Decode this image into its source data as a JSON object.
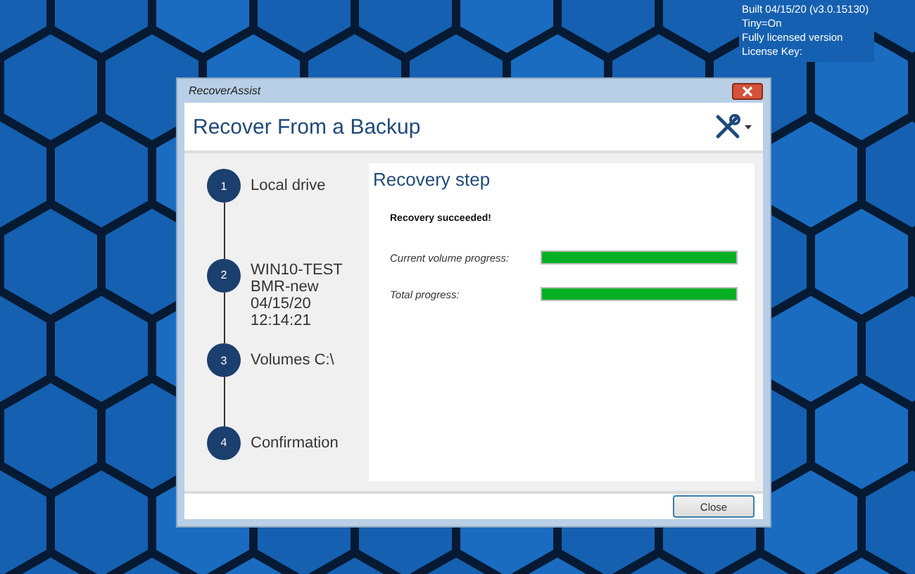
{
  "desktop_info": [
    "Built 04/15/20 (v3.0.15130)",
    "Tiny=On",
    "Fully licensed version",
    "License Key:"
  ],
  "window": {
    "title": "RecoverAssist",
    "heading": "Recover From a Backup"
  },
  "steps": [
    {
      "number": "1",
      "label": "Local drive"
    },
    {
      "number": "2",
      "label": "WIN10-TEST\nBMR-new\n04/15/20\n12:14:21"
    },
    {
      "number": "3",
      "label": "Volumes C:\\"
    },
    {
      "number": "4",
      "label": "Confirmation"
    }
  ],
  "panel": {
    "title": "Recovery step",
    "status": "Recovery succeeded!",
    "progress": [
      {
        "label": "Current volume progress:",
        "level": 1.0
      },
      {
        "label": "Total progress:",
        "level": 1.0
      }
    ]
  },
  "buttons": [
    {
      "label": "Close"
    }
  ]
}
